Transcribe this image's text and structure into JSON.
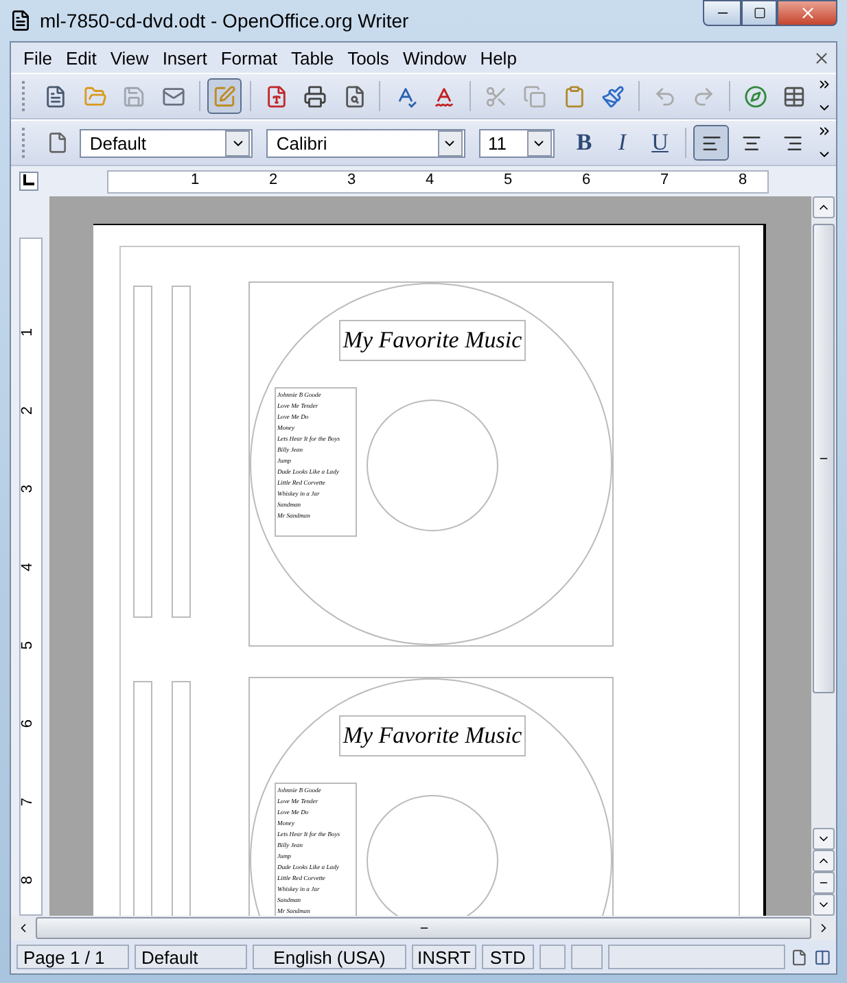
{
  "window": {
    "title": "ml-7850-cd-dvd.odt - OpenOffice.org Writer"
  },
  "menu": [
    "File",
    "Edit",
    "View",
    "Insert",
    "Format",
    "Table",
    "Tools",
    "Window",
    "Help"
  ],
  "standard_toolbar": [
    {
      "kind": "new",
      "selected": false
    },
    {
      "kind": "open",
      "selected": false
    },
    {
      "kind": "save",
      "selected": false
    },
    {
      "kind": "mail",
      "selected": false
    },
    {
      "kind": "edit",
      "selected": true
    },
    {
      "kind": "pdf",
      "selected": false
    },
    {
      "kind": "print",
      "selected": false
    },
    {
      "kind": "preview",
      "selected": false
    },
    {
      "kind": "spell",
      "selected": false
    },
    {
      "kind": "autospell",
      "selected": false
    },
    {
      "kind": "cut",
      "selected": false
    },
    {
      "kind": "copy",
      "selected": false
    },
    {
      "kind": "paste",
      "selected": false
    },
    {
      "kind": "brush",
      "selected": false
    },
    {
      "kind": "undo",
      "selected": false
    },
    {
      "kind": "redo",
      "selected": false
    },
    {
      "kind": "navigator",
      "selected": false
    },
    {
      "kind": "table",
      "selected": false
    }
  ],
  "formatting_toolbar": {
    "style": "Default",
    "font": "Calibri",
    "size": "11",
    "text_buttons": [
      {
        "label": "B",
        "kind": "bold"
      },
      {
        "label": "I",
        "kind": "italic"
      },
      {
        "label": "U",
        "kind": "underline"
      }
    ],
    "alignment": [
      {
        "kind": "left",
        "selected": true
      },
      {
        "kind": "center",
        "selected": false
      },
      {
        "kind": "right",
        "selected": false
      }
    ]
  },
  "ruler_numbers": [
    "1",
    "2",
    "3",
    "4",
    "5",
    "6",
    "7",
    "8"
  ],
  "vertical_ruler_numbers": [
    "1",
    "2",
    "3",
    "4",
    "5",
    "6",
    "7",
    "8"
  ],
  "labels": [
    {
      "title": "My Favorite Music",
      "songs": [
        "Johnnie B Goode",
        "Love Me Tender",
        "Love Me Do",
        "Money",
        "Lets Hear It for the Boys",
        "Billy Jean",
        "Jump",
        "Dude Looks Like a Lady",
        "Little Red Corvette",
        "Whiskey in a Jar",
        "Sandman",
        "Mr Sandman"
      ]
    },
    {
      "title": "My Favorite Music",
      "songs": [
        "Johnnie B Goode",
        "Love Me Tender",
        "Love Me Do",
        "Money",
        "Lets Hear It for the Boys",
        "Billy Jean",
        "Jump",
        "Dude Looks Like a Lady",
        "Little Red Corvette",
        "Whiskey in a Jar",
        "Sandman",
        "Mr Sandman"
      ]
    }
  ],
  "status_bar": [
    "Page 1 / 1",
    "Default",
    "English (USA)",
    "INSRT",
    "STD"
  ]
}
